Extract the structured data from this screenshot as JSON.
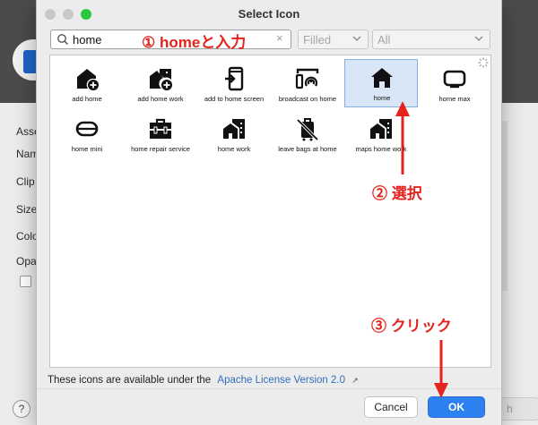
{
  "background": {
    "labels": [
      "Asse",
      "Nam",
      "Clip",
      "Size",
      "Colo",
      "Opa"
    ],
    "help_label": "?",
    "finish_label": "h"
  },
  "dialog": {
    "title": "Select Icon",
    "search": {
      "value": "home",
      "placeholder": ""
    },
    "style_combo": "Filled",
    "category_combo": "All",
    "icons": [
      {
        "name": "add home",
        "icon": "add-home-icon"
      },
      {
        "name": "add home work",
        "icon": "add-home-work-icon"
      },
      {
        "name": "add to home screen",
        "icon": "add-to-home-screen-icon"
      },
      {
        "name": "broadcast on home",
        "icon": "broadcast-on-home-icon"
      },
      {
        "name": "home",
        "icon": "home-icon",
        "selected": true
      },
      {
        "name": "home max",
        "icon": "home-max-icon"
      },
      {
        "name": "home mini",
        "icon": "home-mini-icon"
      },
      {
        "name": "home repair service",
        "icon": "home-repair-service-icon"
      },
      {
        "name": "home work",
        "icon": "home-work-icon"
      },
      {
        "name": "leave bags at home",
        "icon": "leave-bags-at-home-icon"
      },
      {
        "name": "maps home work",
        "icon": "maps-home-work-icon"
      }
    ],
    "license_text": "These icons are available under the",
    "license_link": "Apache License Version 2.0",
    "license_arrow": "↗",
    "cancel_label": "Cancel",
    "ok_label": "OK"
  },
  "annotations": {
    "step1": "① homeと入力",
    "step2": "② 選択",
    "step3": "③ クリック",
    "color": "#e4231d"
  }
}
